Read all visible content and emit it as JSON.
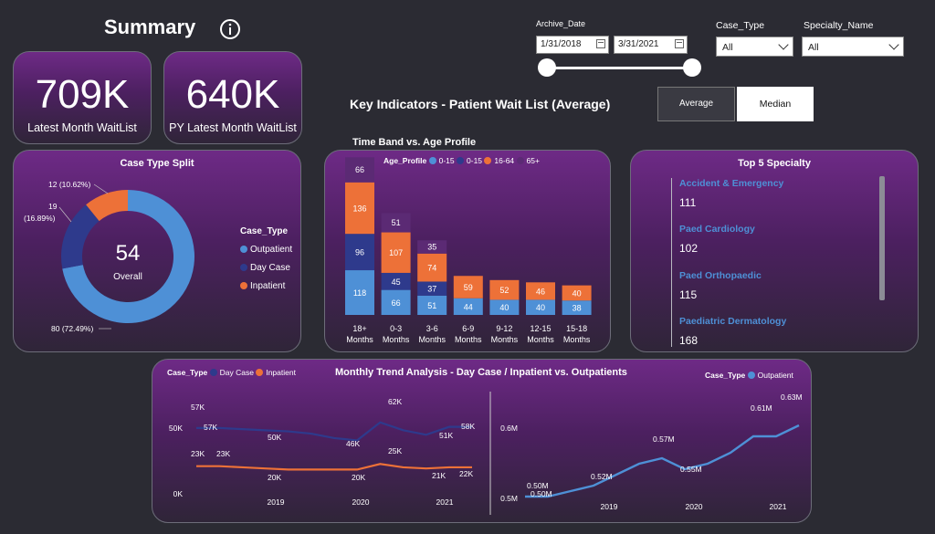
{
  "header": {
    "title": "Summary",
    "info_icon": "info-icon"
  },
  "kpis": [
    {
      "value": "709K",
      "label": "Latest Month WaitList"
    },
    {
      "value": "640K",
      "label": "PY Latest Month WaitList"
    }
  ],
  "filters": {
    "archive_date_label": "Archive_Date",
    "start_date": "1/31/2018",
    "end_date": "3/31/2021",
    "slider_range": [
      0,
      1
    ],
    "case_type_label": "Case_Type",
    "case_type_value": "All",
    "specialty_label": "Specialty_Name",
    "specialty_value": "All"
  },
  "key_indicators": {
    "title": "Key Indicators - Patient Wait List (Average)",
    "buttons": [
      "Average",
      "Median"
    ],
    "selected": "Median"
  },
  "case_type_split": {
    "title": "Case Type Split",
    "center_value": "54",
    "center_label": "Overall",
    "legend_title": "Case_Type",
    "slice_labels": [
      "80 (72.49%)",
      "19",
      "(16.89%)",
      "12 (10.62%)"
    ],
    "colors": {
      "Outpatient": "#4e90d6",
      "Day Case": "#2e3a8c",
      "Inpatient": "#ed7138"
    }
  },
  "time_band": {
    "title": "Time Band vs. Age Profile",
    "legend_title": "Age_Profile",
    "legend": [
      "0-15",
      "0-15",
      "16-64",
      "65+"
    ],
    "x_labels": [
      [
        "18+",
        "Months"
      ],
      [
        "0-3",
        "Months"
      ],
      [
        "3-6",
        "Months"
      ],
      [
        "6-9",
        "Months"
      ],
      [
        "9-12",
        "Months"
      ],
      [
        "12-15",
        "Months"
      ],
      [
        "15-18",
        "Months"
      ]
    ],
    "colors": [
      "#4e90d6",
      "#2e3a8c",
      "#ed7138",
      "#5b2a74"
    ]
  },
  "top5": {
    "title": "Top 5 Specialty",
    "items": [
      {
        "name": "Accident & Emergency",
        "value": "111"
      },
      {
        "name": "Paed Cardiology",
        "value": "102"
      },
      {
        "name": "Paed Orthopaedic",
        "value": "115"
      },
      {
        "name": "Paediatric Dermatology",
        "value": "168"
      }
    ]
  },
  "trend": {
    "title": "Monthly Trend Analysis - Day Case / Inpatient vs. Outpatients",
    "legend_left_title": "Case_Type",
    "legend_left": [
      "Day Case",
      "Inpatient"
    ],
    "legend_right_title": "Case_Type",
    "legend_right": [
      "Outpatient"
    ],
    "left_y_ticks": [
      "50K",
      "0K"
    ],
    "right_y_ticks": [
      "0.6M",
      "0.5M"
    ],
    "x_ticks": [
      "2019",
      "2020",
      "2021"
    ],
    "left_labels": [
      "57K",
      "57K",
      "50K",
      "46K",
      "62K",
      "51K",
      "58K",
      "23K",
      "23K",
      "20K",
      "20K",
      "25K",
      "21K",
      "22K"
    ],
    "right_labels": [
      "0.50M",
      "0.50M",
      "0.52M",
      "0.57M",
      "0.55M",
      "0.61M",
      "0.63M"
    ]
  },
  "chart_data": [
    {
      "type": "pie",
      "title": "Case Type Split",
      "categories": [
        "Outpatient",
        "Day Case",
        "Inpatient"
      ],
      "values": [
        80,
        19,
        12
      ],
      "percent": [
        72.49,
        16.89,
        10.62
      ]
    },
    {
      "type": "bar",
      "title": "Time Band vs. Age Profile",
      "categories": [
        "18+ Months",
        "0-3 Months",
        "3-6 Months",
        "6-9 Months",
        "9-12 Months",
        "12-15 Months",
        "15-18 Months"
      ],
      "series": [
        {
          "name": "0-15",
          "values": [
            118,
            66,
            51,
            44,
            40,
            40,
            38
          ]
        },
        {
          "name": "0-15",
          "values": [
            96,
            45,
            37,
            null,
            null,
            null,
            null
          ]
        },
        {
          "name": "16-64",
          "values": [
            136,
            107,
            74,
            59,
            52,
            46,
            40
          ]
        },
        {
          "name": "65+",
          "values": [
            66,
            51,
            35,
            null,
            null,
            null,
            null
          ]
        }
      ]
    },
    {
      "type": "line",
      "title": "Monthly Trend Analysis - Day Case / Inpatient vs. Outpatients",
      "x": [
        "2018-05",
        "2018-08",
        "2018-11",
        "2019-02",
        "2019-05",
        "2019-08",
        "2019-11",
        "2020-02",
        "2020-05",
        "2020-08",
        "2020-11",
        "2021-02",
        "2021-03"
      ],
      "series": [
        {
          "name": "Day Case",
          "values": [
            57,
            57,
            56,
            55,
            54,
            52,
            48,
            46,
            62,
            55,
            51,
            58,
            58
          ]
        },
        {
          "name": "Inpatient",
          "values": [
            23,
            23,
            22,
            21,
            20,
            20,
            20,
            20,
            25,
            22,
            21,
            22,
            22
          ]
        }
      ],
      "ylim": [
        0,
        70
      ]
    },
    {
      "type": "line",
      "title": "Outpatient",
      "x": [
        "2018-05",
        "2018-08",
        "2018-11",
        "2019-02",
        "2019-05",
        "2019-08",
        "2019-11",
        "2020-02",
        "2020-05",
        "2020-08",
        "2020-11",
        "2021-02",
        "2021-04"
      ],
      "series": [
        {
          "name": "Outpatient",
          "values": [
            0.5,
            0.5,
            0.51,
            0.52,
            0.54,
            0.56,
            0.57,
            0.55,
            0.56,
            0.58,
            0.61,
            0.61,
            0.63
          ]
        }
      ],
      "ylim": [
        0.49,
        0.65
      ]
    }
  ]
}
